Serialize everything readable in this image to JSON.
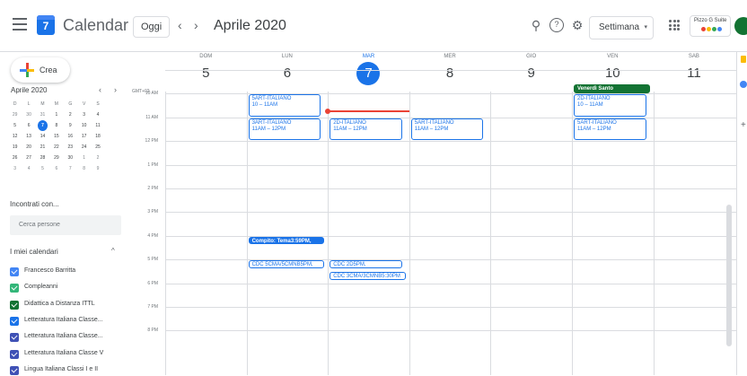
{
  "header": {
    "app_name": "Calendar",
    "logo_day": "7",
    "today_button": "Oggi",
    "prev_icon": "‹",
    "next_icon": "›",
    "month_label": "Aprile 2020",
    "search_icon": "⚲",
    "help_icon": "?",
    "settings_icon": "⚙",
    "view_selector": "Settimana",
    "view_caret": "▾",
    "brand_text": "Pizzo G Suite",
    "brand_colors": [
      "#ea4335",
      "#fbbc04",
      "#34a853",
      "#4285f4"
    ],
    "avatar_color": "#137333"
  },
  "sidebar": {
    "create_label": "Crea",
    "mini_calendar": {
      "title": "Aprile 2020",
      "prev": "‹",
      "next": "›",
      "weekdays": [
        "D",
        "L",
        "M",
        "M",
        "G",
        "V",
        "S"
      ],
      "weeks": [
        [
          "29",
          "30",
          "31",
          "1",
          "2",
          "3",
          "4"
        ],
        [
          "5",
          "6",
          "7",
          "8",
          "9",
          "10",
          "11"
        ],
        [
          "12",
          "13",
          "14",
          "15",
          "16",
          "17",
          "18"
        ],
        [
          "19",
          "20",
          "21",
          "22",
          "23",
          "24",
          "25"
        ],
        [
          "26",
          "27",
          "28",
          "29",
          "30",
          "1",
          "2"
        ],
        [
          "3",
          "4",
          "5",
          "6",
          "7",
          "8",
          "9"
        ]
      ],
      "today": "7"
    },
    "meet_title": "Incontrati con...",
    "search_people_placeholder": "Cerca persone",
    "my_calendars_title": "I miei calendari",
    "my_calendars_caret": "^",
    "calendars": [
      {
        "label": "Francesco Barritta",
        "color": "#4285f4"
      },
      {
        "label": "Compleanni",
        "color": "#33b679"
      },
      {
        "label": "Didattica a Distanza ITTL",
        "color": "#137333"
      },
      {
        "label": "Letteratura Italiana Classe...",
        "color": "#1a73e8"
      },
      {
        "label": "Letteratura Italiana Classe...",
        "color": "#3f51b5"
      },
      {
        "label": "Letteratura Italiana Classe V",
        "color": "#3f51b5"
      },
      {
        "label": "Lingua Italiana Classi I e II",
        "color": "#3f51b5"
      }
    ]
  },
  "week": {
    "timezone": "GMT+02",
    "days": [
      {
        "name": "DOM",
        "num": "5",
        "today": false
      },
      {
        "name": "LUN",
        "num": "6",
        "today": false
      },
      {
        "name": "MAR",
        "num": "7",
        "today": true
      },
      {
        "name": "MER",
        "num": "8",
        "today": false
      },
      {
        "name": "GIO",
        "num": "9",
        "today": false
      },
      {
        "name": "VEN",
        "num": "10",
        "today": false
      },
      {
        "name": "SAB",
        "num": "11",
        "today": false
      }
    ],
    "hours": [
      "9 AM",
      "10 AM",
      "11 AM",
      "12 PM",
      "1 PM",
      "2 PM",
      "3 PM",
      "4 PM",
      "5 PM",
      "6 PM",
      "7 PM",
      "8 PM"
    ],
    "allday_events": [
      {
        "day": 5,
        "title": "Venerdì Santo",
        "color": "#137333"
      }
    ],
    "events": [
      {
        "day": 1,
        "start": 10,
        "end": 11,
        "title": "5ART-ITALIANO",
        "time": "10 – 11AM",
        "style": "outline"
      },
      {
        "day": 1,
        "start": 11,
        "end": 12,
        "title": "3ART-ITALIANO",
        "time": "11AM – 12PM",
        "style": "outline"
      },
      {
        "day": 2,
        "start": 11,
        "end": 12,
        "title": "2D-ITALIANO",
        "time": "11AM – 12PM",
        "style": "outline"
      },
      {
        "day": 3,
        "start": 11,
        "end": 12,
        "title": "5ART-ITALIANO",
        "time": "11AM – 12PM",
        "style": "outline"
      },
      {
        "day": 5,
        "start": 10,
        "end": 11,
        "title": "2D-ITALIANO",
        "time": "10 – 11AM",
        "style": "outline"
      },
      {
        "day": 5,
        "start": 11,
        "end": 12,
        "title": "5ART-ITALIANO",
        "time": "11AM – 12PM",
        "style": "outline"
      },
      {
        "day": 1,
        "start": 16,
        "end": 16.4,
        "title": "Compito: Tema3:59PM,",
        "time": "",
        "style": "filled"
      },
      {
        "day": 1,
        "start": 17,
        "end": 17.4,
        "title": "CDC 5CMA/5CMNB5PM,",
        "time": "",
        "style": "outline"
      },
      {
        "day": 2,
        "start": 17,
        "end": 17.4,
        "title": "CDC 2D5PM,",
        "time": "",
        "style": "outline"
      },
      {
        "day": 2,
        "start": 17.5,
        "end": 17.9,
        "title": "CDC 3CMA/3CMNB5:30PM",
        "time": "",
        "style": "outline"
      }
    ],
    "now": {
      "day": 2,
      "hour": 10.7
    }
  }
}
